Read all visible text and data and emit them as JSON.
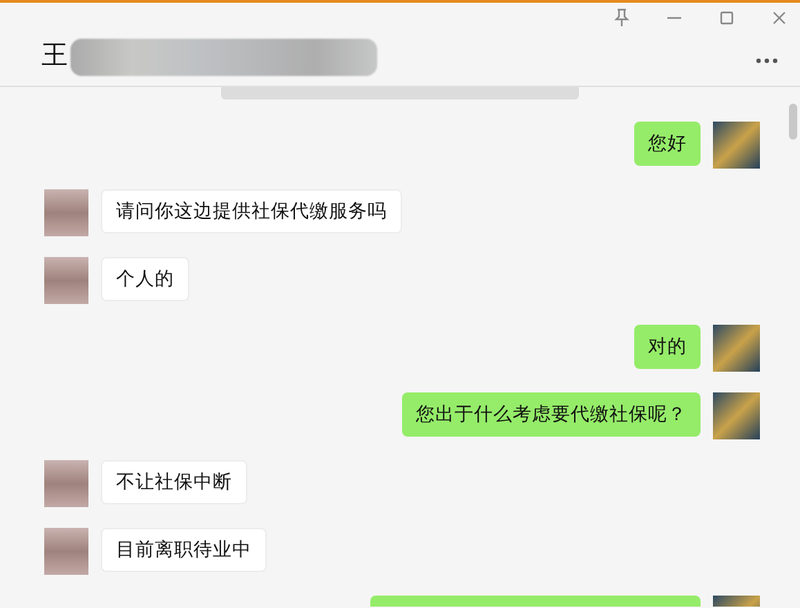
{
  "window": {
    "title": "王"
  },
  "messages": [
    {
      "kind": "sent",
      "text": "您好"
    },
    {
      "kind": "received",
      "text": "请问你这边提供社保代缴服务吗"
    },
    {
      "kind": "received",
      "text": "个人的"
    },
    {
      "kind": "sent",
      "text": "对的"
    },
    {
      "kind": "sent",
      "text": "您出于什么考虑要代缴社保呢？"
    },
    {
      "kind": "received",
      "text": "不让社保中断"
    },
    {
      "kind": "received",
      "text": "目前离职待业中"
    },
    {
      "kind": "sent"
    }
  ]
}
